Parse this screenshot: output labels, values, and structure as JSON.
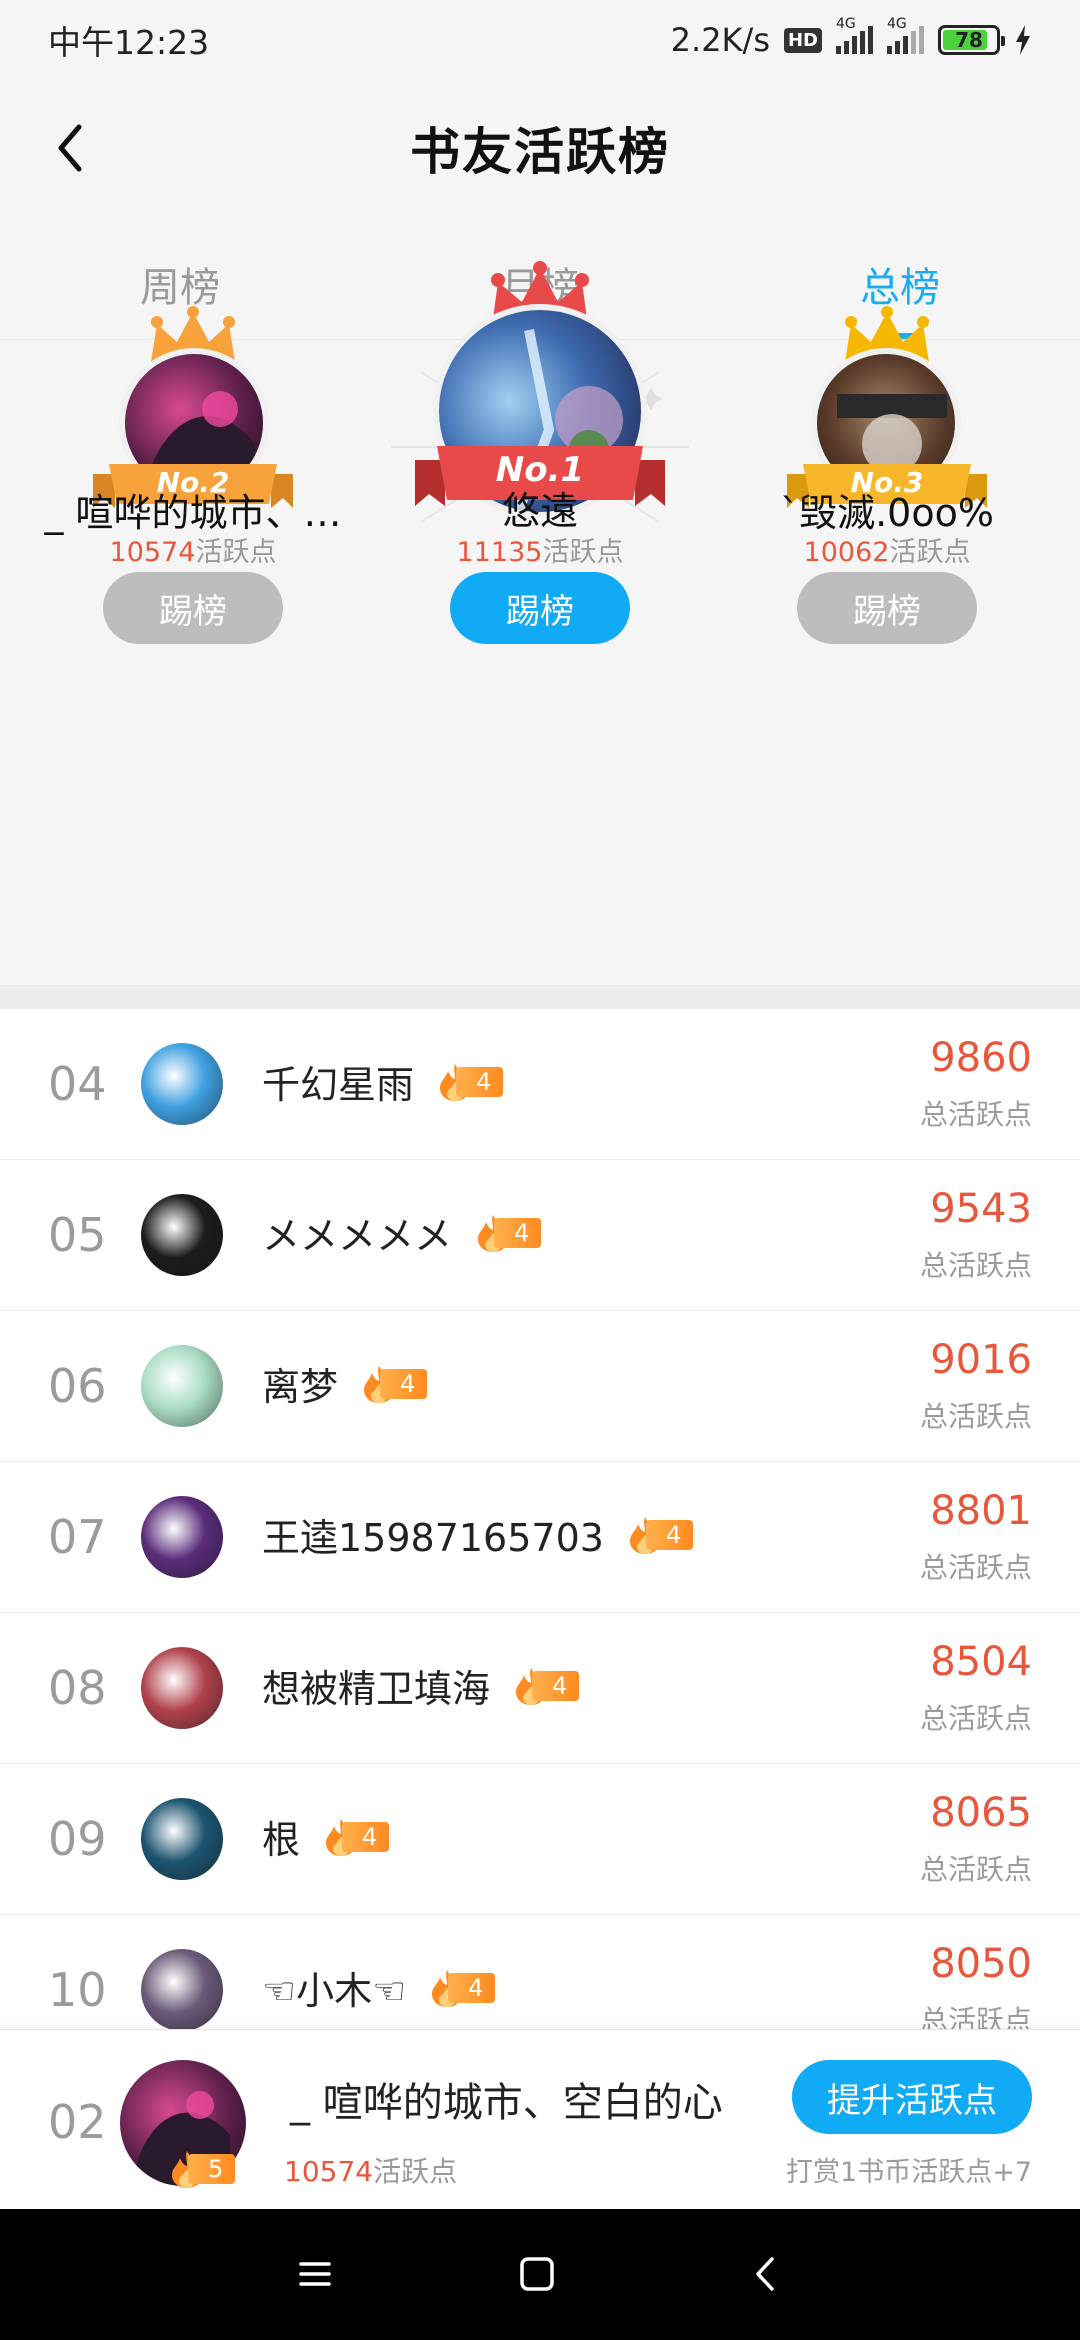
{
  "status_bar": {
    "time": "中午12:23",
    "network_speed": "2.2K/s",
    "hd": "HD",
    "signal1_label": "4G",
    "signal2_label": "4G",
    "battery": "78"
  },
  "header": {
    "title": "书友活跃榜"
  },
  "tabs": [
    {
      "label": "周榜",
      "active": false
    },
    {
      "label": "月榜",
      "active": false
    },
    {
      "label": "总榜",
      "active": true
    }
  ],
  "podium": {
    "first": {
      "badge": "No.1",
      "name": "悠遠",
      "points": "11135",
      "points_unit": "活跃点",
      "button": "踢榜"
    },
    "second": {
      "badge": "No.2",
      "name": "_ 喧哗的城市、…",
      "points": "10574",
      "points_unit": "活跃点",
      "button": "踢榜"
    },
    "third": {
      "badge": "No.3",
      "name": "`毁滅.0oo%",
      "points": "10062",
      "points_unit": "活跃点",
      "button": "踢榜"
    }
  },
  "list": {
    "score_label": "总活跃点",
    "rows": [
      {
        "rank": "04",
        "name": "千幻星雨",
        "level": "4",
        "score": "9860",
        "avatar_color": "#3fa0e0"
      },
      {
        "rank": "05",
        "name": "メメメメメ",
        "level": "4",
        "score": "9543",
        "avatar_color": "#1c1c1c"
      },
      {
        "rank": "06",
        "name": "离梦",
        "level": "4",
        "score": "9016",
        "avatar_color": "#a9dcc4"
      },
      {
        "rank": "07",
        "name": "王逵15987165703",
        "level": "4",
        "score": "8801",
        "avatar_color": "#5a2c7a"
      },
      {
        "rank": "08",
        "name": "想被精卫填海",
        "level": "4",
        "score": "8504",
        "avatar_color": "#b0414b"
      },
      {
        "rank": "09",
        "name": "根",
        "level": "4",
        "score": "8065",
        "avatar_color": "#1c5470"
      },
      {
        "rank": "10",
        "name": "☜小木☜",
        "level": "4",
        "score": "8050",
        "avatar_color": "#6b5a7a"
      }
    ]
  },
  "my_rank": {
    "rank": "02",
    "name": "_ 喧哗的城市、空白的心",
    "level": "5",
    "points": "10574",
    "points_unit": "活跃点",
    "button": "提升活跃点",
    "hint": "打赏1书币活跃点+7"
  },
  "colors": {
    "accent": "#11aaf4",
    "score": "#e8573c",
    "gold": "#f5b800",
    "ribbon_first": "#e84a4a",
    "ribbon_second": "#f7a23a",
    "ribbon_third": "#f8b72a"
  },
  "icons": {
    "back": "chevron-left-icon",
    "crown": "crown-icon",
    "flame": "flame-icon",
    "nav_menu": "menu-icon",
    "nav_home": "square-icon",
    "nav_back": "back-triangle-icon"
  }
}
